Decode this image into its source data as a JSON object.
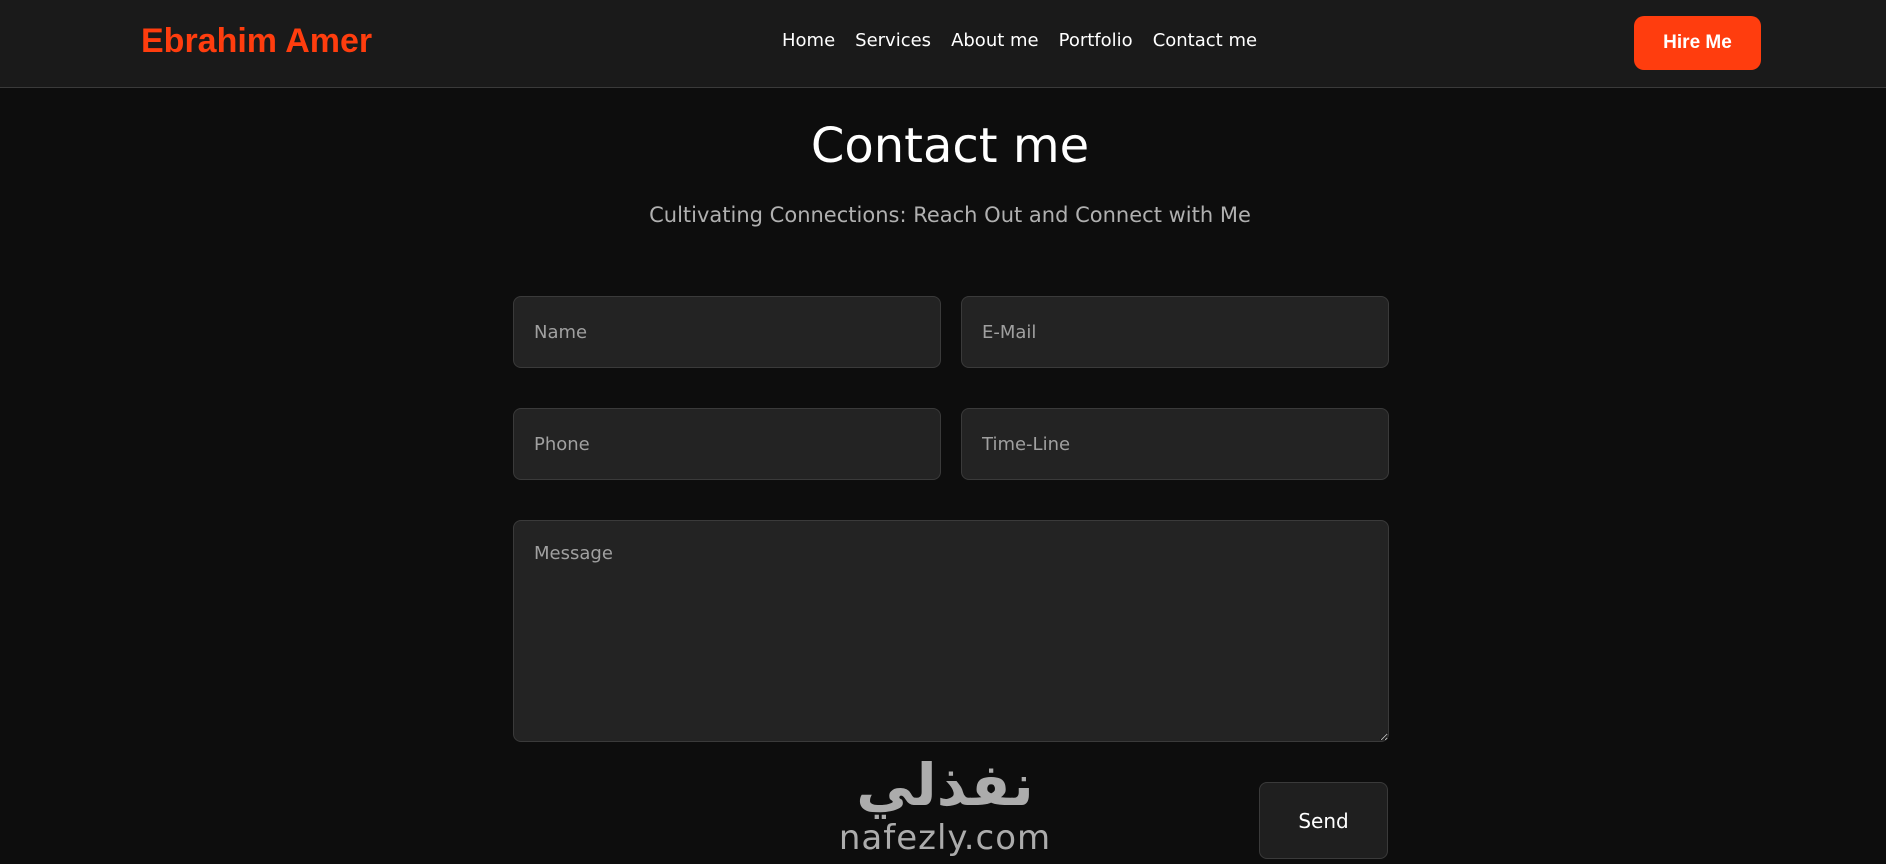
{
  "header": {
    "brand": "Ebrahim Amer",
    "nav": [
      "Home",
      "Services",
      "About me",
      "Portfolio",
      "Contact me"
    ],
    "cta_label": "Hire Me"
  },
  "contact": {
    "title": "Contact me",
    "subtitle": "Cultivating Connections: Reach Out and Connect with Me",
    "fields": {
      "name_placeholder": "Name",
      "email_placeholder": "E-Mail",
      "phone_placeholder": "Phone",
      "timeline_placeholder": "Time-Line",
      "message_placeholder": "Message"
    },
    "send_label": "Send"
  },
  "watermark": {
    "arabic": "نفذلي",
    "latin": "nafezly.com"
  },
  "colors": {
    "accent": "#ff3d0e",
    "background": "#0d0d0d",
    "navbar": "#1a1a1a",
    "field": "#232323"
  }
}
